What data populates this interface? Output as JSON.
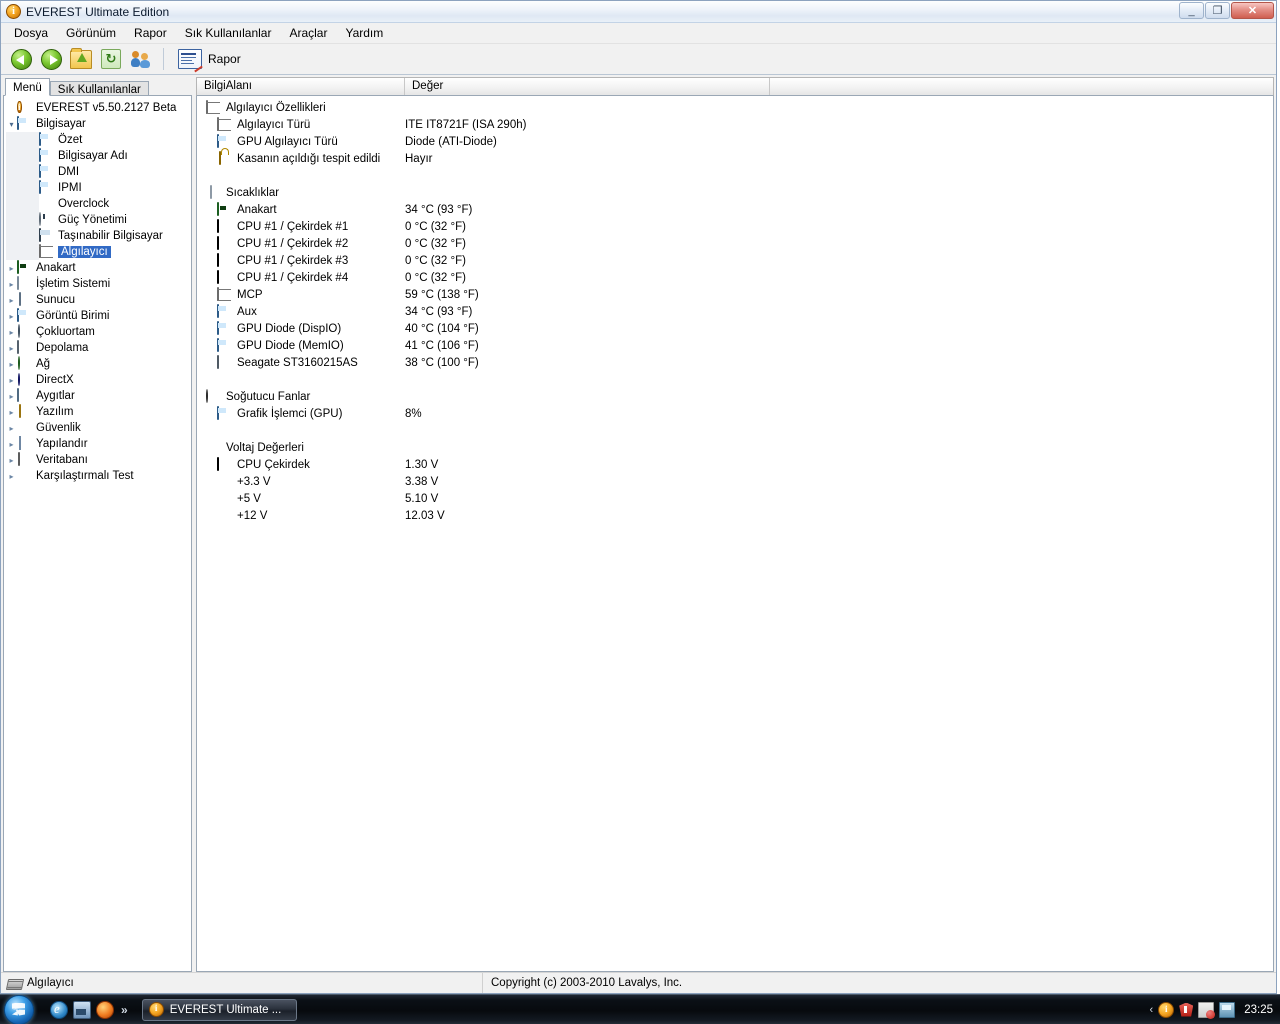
{
  "window": {
    "title": "EVEREST Ultimate Edition",
    "icon": "info-icon",
    "buttons": {
      "minimize": "_",
      "maximize": "❐",
      "close": "✕"
    }
  },
  "menubar": {
    "items": [
      {
        "label": "Dosya",
        "name": "menu-dosya"
      },
      {
        "label": "Görünüm",
        "name": "menu-gorunum"
      },
      {
        "label": "Rapor",
        "name": "menu-rapor"
      },
      {
        "label": "Sık Kullanılanlar",
        "name": "menu-sik-kullanilanlar"
      },
      {
        "label": "Araçlar",
        "name": "menu-araclar"
      },
      {
        "label": "Yardım",
        "name": "menu-yardim"
      }
    ]
  },
  "toolbar": {
    "back_label": "Geri",
    "forward_label": "İleri",
    "up_label": "Yukarı",
    "refresh_label": "Yenile",
    "users_label": "Kullanıcılar",
    "report_label": "Rapor"
  },
  "tabs": [
    {
      "label": "Menü",
      "active": true
    },
    {
      "label": "Sık Kullanılanlar",
      "active": false
    }
  ],
  "tree": {
    "root": {
      "label": "EVEREST v5.50.2127 Beta",
      "icon": "info-icon"
    },
    "nodes": [
      {
        "label": "Bilgisayar",
        "icon": "ic-pc",
        "indent": 1,
        "expander": "down"
      },
      {
        "label": "Özet",
        "icon": "ic-pc",
        "indent": 2,
        "expander": ""
      },
      {
        "label": "Bilgisayar Adı",
        "icon": "ic-pc",
        "indent": 2,
        "expander": ""
      },
      {
        "label": "DMI",
        "icon": "ic-pc",
        "indent": 2,
        "expander": ""
      },
      {
        "label": "IPMI",
        "icon": "ic-pc",
        "indent": 2,
        "expander": ""
      },
      {
        "label": "Overclock",
        "icon": "ic-fire",
        "indent": 2,
        "expander": ""
      },
      {
        "label": "Güç Yönetimi",
        "icon": "ic-power",
        "indent": 2,
        "expander": ""
      },
      {
        "label": "Taşınabilir Bilgisayar",
        "icon": "ic-laptop",
        "indent": 2,
        "expander": ""
      },
      {
        "label": "Algılayıcı",
        "icon": "ic-chip",
        "indent": 2,
        "expander": "",
        "selected": true
      },
      {
        "label": "Anakart",
        "icon": "ic-mb",
        "indent": 1,
        "expander": "right"
      },
      {
        "label": "İşletim Sistemi",
        "icon": "ic-os",
        "indent": 1,
        "expander": "right"
      },
      {
        "label": "Sunucu",
        "icon": "ic-server",
        "indent": 1,
        "expander": "right"
      },
      {
        "label": "Görüntü Birimi",
        "icon": "ic-pc",
        "indent": 1,
        "expander": "right"
      },
      {
        "label": "Çokluortam",
        "icon": "ic-multi",
        "indent": 1,
        "expander": "right"
      },
      {
        "label": "Depolama",
        "icon": "ic-storage",
        "indent": 1,
        "expander": "right"
      },
      {
        "label": "Ağ",
        "icon": "ic-net",
        "indent": 1,
        "expander": "right"
      },
      {
        "label": "DirectX",
        "icon": "ic-dx",
        "indent": 1,
        "expander": "right"
      },
      {
        "label": "Aygıtlar",
        "icon": "ic-dev",
        "indent": 1,
        "expander": "right"
      },
      {
        "label": "Yazılım",
        "icon": "ic-soft",
        "indent": 1,
        "expander": "right"
      },
      {
        "label": "Güvenlik",
        "icon": "ic-sec",
        "indent": 1,
        "expander": "right"
      },
      {
        "label": "Yapılandır",
        "icon": "ic-cfg",
        "indent": 1,
        "expander": "right"
      },
      {
        "label": "Veritabanı",
        "icon": "ic-db",
        "indent": 1,
        "expander": "right"
      },
      {
        "label": "Karşılaştırmalı Test",
        "icon": "ic-bench",
        "indent": 1,
        "expander": "right"
      }
    ]
  },
  "grid": {
    "columns": [
      {
        "label": "BilgiAlanı"
      },
      {
        "label": "Değer"
      },
      {
        "label": ""
      }
    ],
    "sections": [
      {
        "title": "Algılayıcı Özellikleri",
        "icon": "ic-chip",
        "rows": [
          {
            "name": "Algılayıcı Türü",
            "icon": "ic-chip",
            "value": "ITE IT8721F  (ISA 290h)"
          },
          {
            "name": "GPU Algılayıcı Türü",
            "icon": "ic-pc",
            "value": "Diode  (ATI-Diode)"
          },
          {
            "name": "Kasanın açıldığı tespit edildi",
            "icon": "ic-lock",
            "value": "Hayır"
          }
        ]
      },
      {
        "title": "Sıcaklıklar",
        "icon": "ic-temp",
        "rows": [
          {
            "name": "Anakart",
            "icon": "ic-mb",
            "value": "34 °C  (93 °F)"
          },
          {
            "name": "CPU #1 / Çekirdek #1",
            "icon": "ic-chip-dark",
            "value": "0 °C  (32 °F)"
          },
          {
            "name": "CPU #1 / Çekirdek #2",
            "icon": "ic-chip-dark",
            "value": "0 °C  (32 °F)"
          },
          {
            "name": "CPU #1 / Çekirdek #3",
            "icon": "ic-chip-dark",
            "value": "0 °C  (32 °F)"
          },
          {
            "name": "CPU #1 / Çekirdek #4",
            "icon": "ic-chip-dark",
            "value": "0 °C  (32 °F)"
          },
          {
            "name": "MCP",
            "icon": "ic-chip",
            "value": "59 °C  (138 °F)"
          },
          {
            "name": "Aux",
            "icon": "ic-pc",
            "value": "34 °C  (93 °F)"
          },
          {
            "name": "GPU Diode (DispIO)",
            "icon": "ic-pc",
            "value": "40 °C  (104 °F)"
          },
          {
            "name": "GPU Diode (MemIO)",
            "icon": "ic-pc",
            "value": "41 °C  (106 °F)"
          },
          {
            "name": "Seagate ST3160215AS",
            "icon": "ic-hdd",
            "value": "38 °C  (100 °F)"
          }
        ]
      },
      {
        "title": "Soğutucu Fanlar",
        "icon": "ic-fan",
        "rows": [
          {
            "name": "Grafik İşlemci (GPU)",
            "icon": "ic-pc",
            "value": "8%"
          }
        ]
      },
      {
        "title": "Voltaj Değerleri",
        "icon": "ic-volt",
        "rows": [
          {
            "name": "CPU Çekirdek",
            "icon": "ic-chip-dark",
            "value": "1.30 V"
          },
          {
            "name": "+3.3 V",
            "icon": "ic-volt",
            "value": "3.38 V"
          },
          {
            "name": "+5 V",
            "icon": "ic-volt",
            "value": "5.10 V"
          },
          {
            "name": "+12 V",
            "icon": "ic-volt",
            "value": "12.03 V"
          }
        ]
      }
    ]
  },
  "statusbar": {
    "left": "Algılayıcı",
    "right": "Copyright (c) 2003-2010 Lavalys, Inc."
  },
  "taskbar": {
    "start_label": "Başlat",
    "quicklaunch": [
      {
        "name": "internet-explorer-icon"
      },
      {
        "name": "show-desktop-icon"
      },
      {
        "name": "firefox-icon"
      }
    ],
    "overflow_label": "»",
    "task_button": {
      "label": "EVEREST Ultimate ...",
      "icon": "info-icon"
    },
    "tray": {
      "expand_label": "‹",
      "icons": [
        {
          "name": "everest-tray-icon"
        },
        {
          "name": "antivirus-shield-icon"
        },
        {
          "name": "action-center-icon"
        },
        {
          "name": "network-icon"
        }
      ],
      "clock": "23:25"
    }
  },
  "colors": {
    "selection": "#316ac5",
    "title_accent": "#f5a623",
    "window_border": "#8ca2be"
  }
}
